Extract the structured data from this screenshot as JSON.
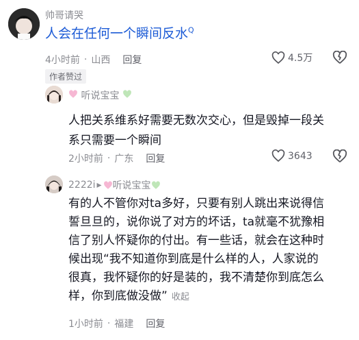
{
  "comment1": {
    "username": "帅哥请哭",
    "text": "人会在任何一个瞬间反水",
    "search_glyph": "Q",
    "time": "4小时前",
    "location": "山西",
    "reply_label": "回复",
    "likes": "4.5万",
    "badge": "作者赞过"
  },
  "comment2": {
    "username": "听说宝宝",
    "line1": "人把关系维系好需要无数次交心，但是毁掉一段关",
    "line2": "系只需要一个瞬间",
    "time": "2小时前",
    "location": "广东",
    "reply_label": "回复",
    "likes": "3643"
  },
  "comment3": {
    "username": "2222i",
    "reply_to": "听说宝宝",
    "lines": [
      "有的人不管你对ta多好，只要有别人跳出来说得信",
      "誓旦旦的，说你说了对方的坏话，ta就毫不犹豫相",
      "信了别人怀疑你的付出。有一些话，就会在这种时",
      "候出现“我不知道你到底是什么样的人，人家说的",
      "很真，我怀疑你的好是装的，我不清楚你到底怎么",
      "样，你到底做没做”"
    ],
    "collapse_label": "收起",
    "time": "1小时前",
    "location": "福建",
    "reply_label": "回复"
  },
  "colors": {
    "link_blue": "#1c5bd6",
    "heart_pink": "#f6b7d3",
    "heart_green": "#bfe6b8",
    "meta_gray": "#8a8b91"
  }
}
